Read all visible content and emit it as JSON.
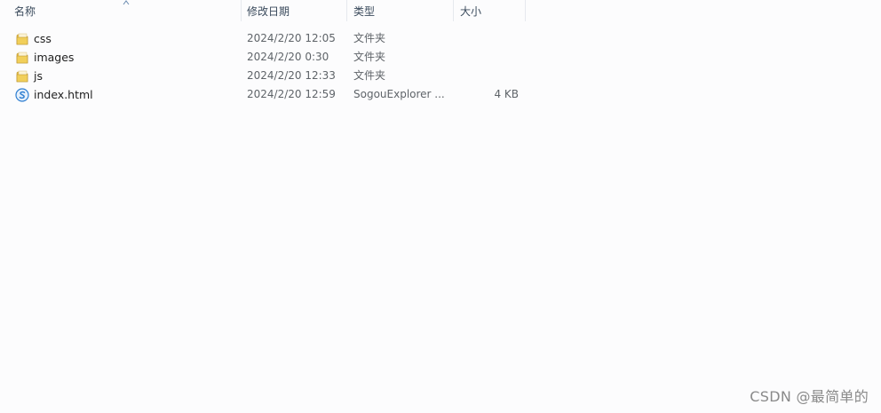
{
  "columns": {
    "name": "名称",
    "date": "修改日期",
    "type": "类型",
    "size": "大小"
  },
  "files": [
    {
      "icon": "folder-icon",
      "name": "css",
      "date": "2024/2/20 12:05",
      "type": "文件夹",
      "size": ""
    },
    {
      "icon": "folder-icon",
      "name": "images",
      "date": "2024/2/20 0:30",
      "type": "文件夹",
      "size": ""
    },
    {
      "icon": "folder-icon",
      "name": "js",
      "date": "2024/2/20 12:33",
      "type": "文件夹",
      "size": ""
    },
    {
      "icon": "sogou-browser-file-icon",
      "name": "index.html",
      "date": "2024/2/20 12:59",
      "type": "SogouExplorer ...",
      "size": "4 KB"
    }
  ],
  "watermark": "CSDN @最简单的",
  "colors": {
    "background": "#fcfcfd",
    "header_text": "#3a4a5c",
    "folder": "#e8c04a",
    "file_icon": "#2f7fd1"
  }
}
